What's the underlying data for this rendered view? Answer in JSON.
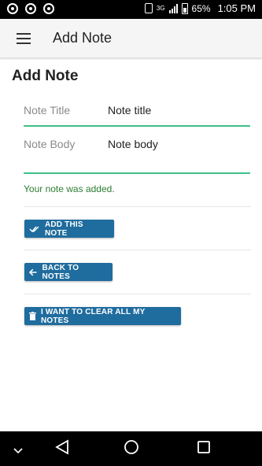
{
  "status_bar": {
    "signal_label": "3G",
    "battery_percent": "65%",
    "time": "1:05 PM"
  },
  "app_bar": {
    "title": "Add Note"
  },
  "page": {
    "heading": "Add Note"
  },
  "form": {
    "title_label": "Note Title",
    "title_value": "Note title",
    "body_label": "Note Body",
    "body_value": "Note body",
    "success_message": "Your note was added."
  },
  "buttons": {
    "add_label": "ADD THIS NOTE",
    "back_label": "BACK TO NOTES",
    "clear_label": "I WANT TO CLEAR ALL MY NOTES"
  },
  "colors": {
    "accent_underline": "#3fc088",
    "button_bg": "#1f6c9e",
    "success_text": "#2e7d32"
  },
  "icons": {
    "menu": "hamburger-menu-icon",
    "add": "double-check-icon",
    "back": "arrow-left-icon",
    "clear": "trash-icon",
    "nav_down": "chevron-down-icon",
    "nav_back": "triangle-back-icon",
    "nav_home": "circle-home-icon",
    "nav_recent": "square-recent-icon"
  }
}
